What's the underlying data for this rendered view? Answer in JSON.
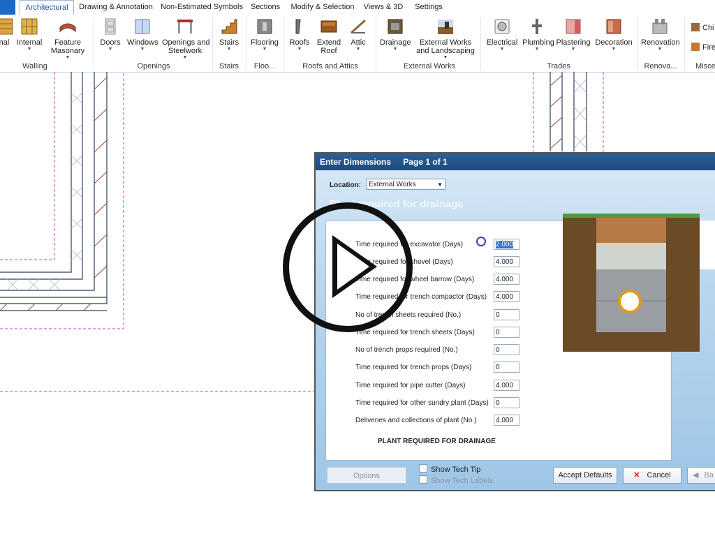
{
  "tabs": [
    {
      "label": "Architectural",
      "active": true
    },
    {
      "label": "Drawing & Annotation"
    },
    {
      "label": "Non-Estimated Symbols"
    },
    {
      "label": "Sections"
    },
    {
      "label": "Modify & Selection"
    },
    {
      "label": "Views & 3D"
    },
    {
      "label": "Settings"
    }
  ],
  "ribbon": {
    "buttons": [
      {
        "label": "nal",
        "icon": "wall-icon"
      },
      {
        "label": "Internal",
        "icon": "internal-wall-icon"
      },
      {
        "label": "Feature\nMasonary",
        "icon": "masonry-icon"
      },
      {
        "label": "Doors",
        "icon": "door-icon"
      },
      {
        "label": "Windows",
        "icon": "window-icon"
      },
      {
        "label": "Openings and\nSteelwork",
        "icon": "opening-icon"
      },
      {
        "label": "Stairs",
        "icon": "stairs-icon"
      },
      {
        "label": "Flooring",
        "icon": "flooring-icon"
      },
      {
        "label": "Roofs",
        "icon": "roof-icon"
      },
      {
        "label": "Extend\nRoof",
        "icon": "extend-roof-icon"
      },
      {
        "label": "Attic",
        "icon": "attic-icon"
      },
      {
        "label": "Drainage",
        "icon": "drainage-icon"
      },
      {
        "label": "External Works\nand Landscaping",
        "icon": "landscaping-icon"
      },
      {
        "label": "Electrical",
        "icon": "electrical-icon"
      },
      {
        "label": "Plumbing",
        "icon": "plumbing-icon"
      },
      {
        "label": "Plastering",
        "icon": "plastering-icon"
      },
      {
        "label": "Decoration",
        "icon": "decoration-icon"
      },
      {
        "label": "Renovation",
        "icon": "renovation-icon"
      }
    ],
    "small_buttons": [
      {
        "label": "Chi",
        "icon": "chimney-icon"
      },
      {
        "label": "Fire",
        "icon": "fireplace-icon"
      }
    ],
    "groups": [
      "Walling",
      "Openings",
      "Stairs",
      "Floo...",
      "Roofs and Attics",
      "External Works",
      "Trades",
      "Renova...",
      "Miscell"
    ]
  },
  "dialog": {
    "title": "Enter Dimensions",
    "page": "Page 1 of 1",
    "location_label": "Location:",
    "location_value": "External Works",
    "section_title": "Plant required for drainage",
    "fields": [
      {
        "label": "Time required for excavator (Days)",
        "value": "2.000",
        "selected": true
      },
      {
        "label": "Time required for shovel (Days)",
        "value": "4.000"
      },
      {
        "label": "Time required for wheel barrow (Days)",
        "value": "4.000"
      },
      {
        "label": "Time required for trench compactor (Days)",
        "value": "4.000"
      },
      {
        "label": "No of trench sheets required (No.)",
        "value": "0"
      },
      {
        "label": "Time required for trench sheets (Days)",
        "value": "0"
      },
      {
        "label": "No of trench props required (No.)",
        "value": "0"
      },
      {
        "label": "Time required for trench props (Days)",
        "value": "0"
      },
      {
        "label": "Time required for pipe cutter (Days)",
        "value": "4.000"
      },
      {
        "label": "Time required for other sundry plant (Days)",
        "value": "0"
      },
      {
        "label": "Deliveries and collections of plant (No.)",
        "value": "4.000"
      }
    ],
    "caption": "PLANT REQUIRED FOR DRAINAGE",
    "options_label": "Options",
    "show_tech_tip": "Show Tech Tip",
    "show_tech_labels": "Show Tech Labels",
    "accept_defaults": "Accept Defaults",
    "cancel": "Cancel",
    "back": "Ba"
  },
  "colors": {
    "accent": "#1f4f8f",
    "title_bar": "#1d4a7d",
    "drawing_lines": "#2c3e5c",
    "guide_lines": "#c040c0",
    "hatch": "#a04040"
  }
}
